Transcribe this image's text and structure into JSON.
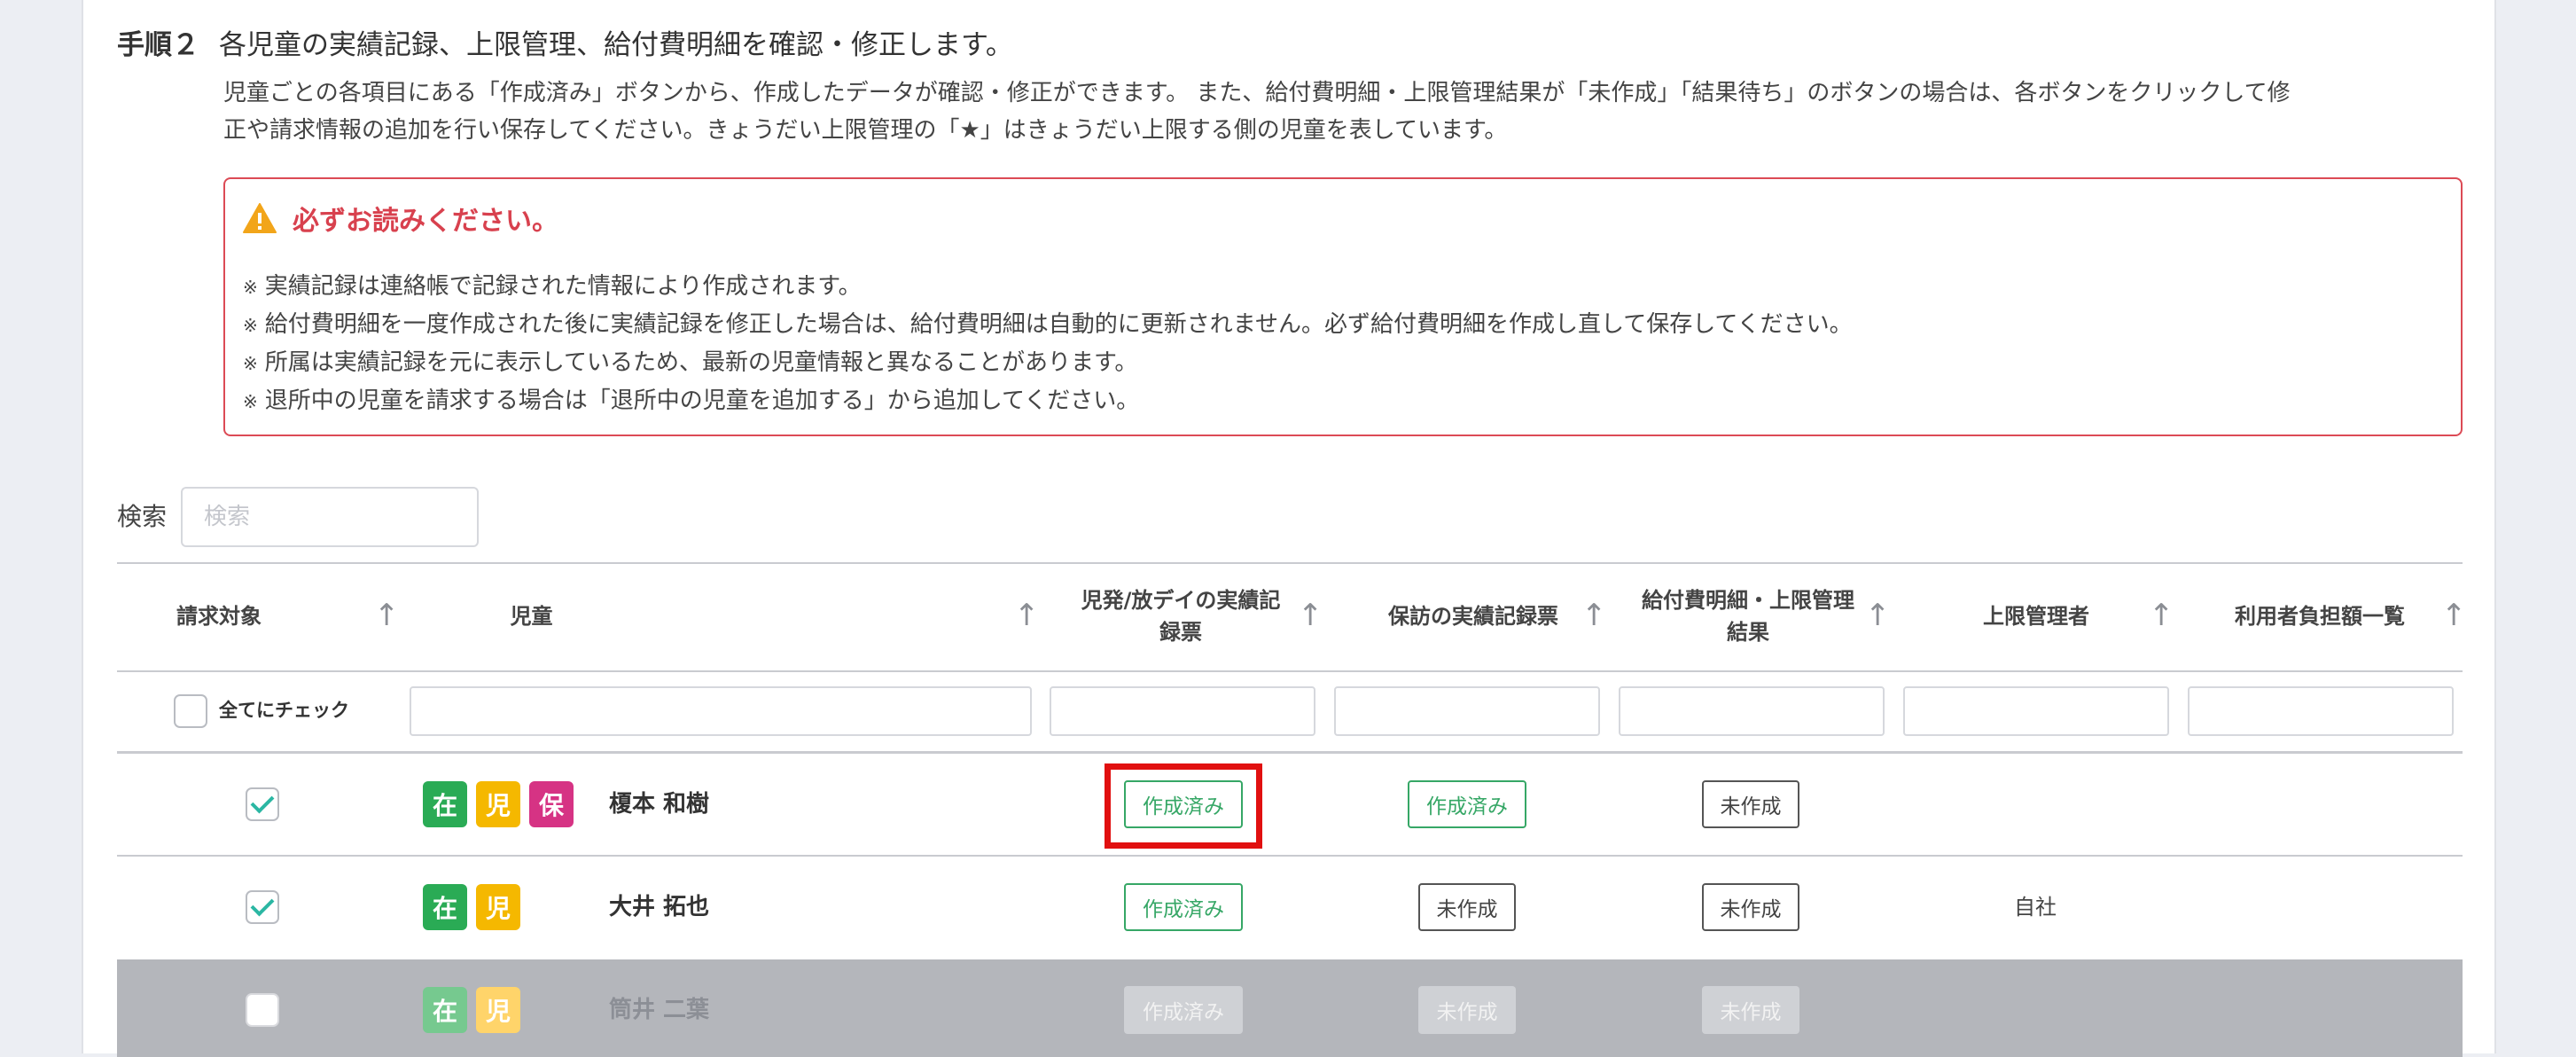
{
  "step": {
    "label": "手順２",
    "title": "各児童の実績記録、上限管理、給付費明細を確認・修正します。",
    "description_line1": "児童ごとの各項目にある「作成済み」ボタンから、作成したデータが確認・修正ができます。 また、給付費明細・上限管理結果が「未作成」「結果待ち」のボタンの場合は、各ボタンをクリックして修",
    "description_line2": "正や請求情報の追加を行い保存してください。きょうだい上限管理の「★」はきょうだい上限する側の児童を表しています。"
  },
  "alert": {
    "title": "必ずお読みください。",
    "mark": "※",
    "items": [
      "実績記録は連絡帳で記録された情報により作成されます。",
      "給付費明細を一度作成された後に実績記録を修正した場合は、給付費明細は自動的に更新されません。必ず給付費明細を作成し直して保存してください。",
      "所属は実績記録を元に表示しているため、最新の児童情報と異なることがあります。",
      "退所中の児童を請求する場合は「退所中の児童を追加する」から追加してください。"
    ]
  },
  "search": {
    "label": "検索",
    "placeholder": "検索"
  },
  "table": {
    "headers": {
      "billing": "請求対象",
      "child": "児童",
      "jihatsu_line1": "児発/放デイの実績記",
      "jihatsu_line2": "録票",
      "hoho": "保訪の実績記録票",
      "kyufu_line1": "給付費明細・上限管理",
      "kyufu_line2": "結果",
      "manager": "上限管理者",
      "burden": "利用者負担額一覧"
    },
    "sort_arrow": "↑",
    "check_all_label": "全てにチェック",
    "rows": [
      {
        "checked": true,
        "badges": [
          "在",
          "児",
          "保"
        ],
        "name": "榎本 和樹",
        "jihatsu": "作成済み",
        "hoho": "作成済み",
        "kyufu": "未作成",
        "manager": "",
        "disabled": false
      },
      {
        "checked": true,
        "badges": [
          "在",
          "児"
        ],
        "name": "大井 拓也",
        "jihatsu": "作成済み",
        "hoho": "未作成",
        "kyufu": "未作成",
        "manager": "自社",
        "disabled": false
      },
      {
        "checked": false,
        "badges": [
          "在",
          "児"
        ],
        "name": "筒井 二葉",
        "jihatsu": "作成済み",
        "hoho": "未作成",
        "kyufu": "未作成",
        "manager": "",
        "disabled": true
      }
    ]
  },
  "colors": {
    "badge_zai": "#2aab55",
    "badge_ji": "#f5b800",
    "badge_ho": "#d63384",
    "done_button": "#36a766",
    "alert_red": "#d8414e",
    "highlight_red": "#e11010"
  }
}
